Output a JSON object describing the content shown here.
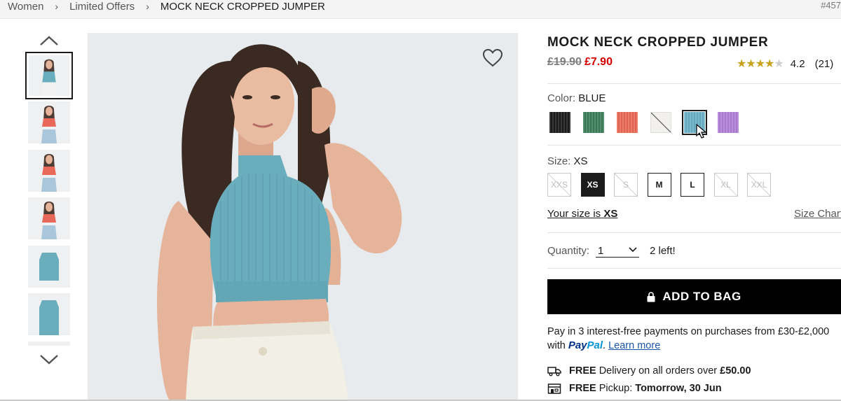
{
  "breadcrumb": {
    "items": [
      "Women",
      "Limited Offers"
    ],
    "current": "MOCK NECK CROPPED JUMPER",
    "separator": "›",
    "product_code": "#457"
  },
  "gallery": {
    "thumbnail_count": 7,
    "active_index": 0,
    "colors": {
      "top": "#6aaebe",
      "top_red": "#e8685a",
      "skin": "#e5b49a",
      "hair": "#3a2a22",
      "bg": "#eef0f1"
    }
  },
  "product": {
    "title": "MOCK NECK CROPPED JUMPER",
    "old_price": "£19.90",
    "new_price": "£7.90",
    "rating": {
      "score": "4.2",
      "count": "(21)",
      "stars": 4.2
    }
  },
  "color": {
    "label": "Color:",
    "selected": "BLUE",
    "swatches": [
      {
        "name": "black",
        "hex": "#1c1c1c"
      },
      {
        "name": "green",
        "hex": "#3e7f5a"
      },
      {
        "name": "red",
        "hex": "#ec6a55"
      },
      {
        "name": "off-white",
        "hex": "#f1f0ec",
        "unavailable": true
      },
      {
        "name": "blue",
        "hex": "#6ab0c8",
        "selected": true
      },
      {
        "name": "purple",
        "hex": "#b181d8"
      }
    ]
  },
  "size": {
    "label": "Size:",
    "selected": "XS",
    "options": [
      {
        "label": "XXS",
        "available": false
      },
      {
        "label": "XS",
        "available": true,
        "selected": true
      },
      {
        "label": "S",
        "available": false
      },
      {
        "label": "M",
        "available": true
      },
      {
        "label": "L",
        "available": true
      },
      {
        "label": "XL",
        "available": false
      },
      {
        "label": "XXL",
        "available": false
      }
    ],
    "your_size_prefix": "Your size is",
    "your_size_value": "XS",
    "chart_link": "Size Chart"
  },
  "quantity": {
    "label": "Quantity:",
    "value": "1",
    "stock_note": "2 left!"
  },
  "cta": {
    "add_to_bag": "ADD TO BAG"
  },
  "paypal": {
    "text": "Pay in 3 interest-free payments on purchases from £30-£2,000 with",
    "logo_a": "Pay",
    "logo_b": "Pal",
    "period": ".",
    "link": "Learn more"
  },
  "shipping": [
    {
      "bold": "FREE",
      "text": "Delivery on all orders over",
      "value": "£50.00",
      "icon": "truck-icon"
    },
    {
      "bold": "FREE",
      "text": "Pickup:",
      "value": "Tomorrow, 30 Jun",
      "icon": "store-icon"
    }
  ]
}
